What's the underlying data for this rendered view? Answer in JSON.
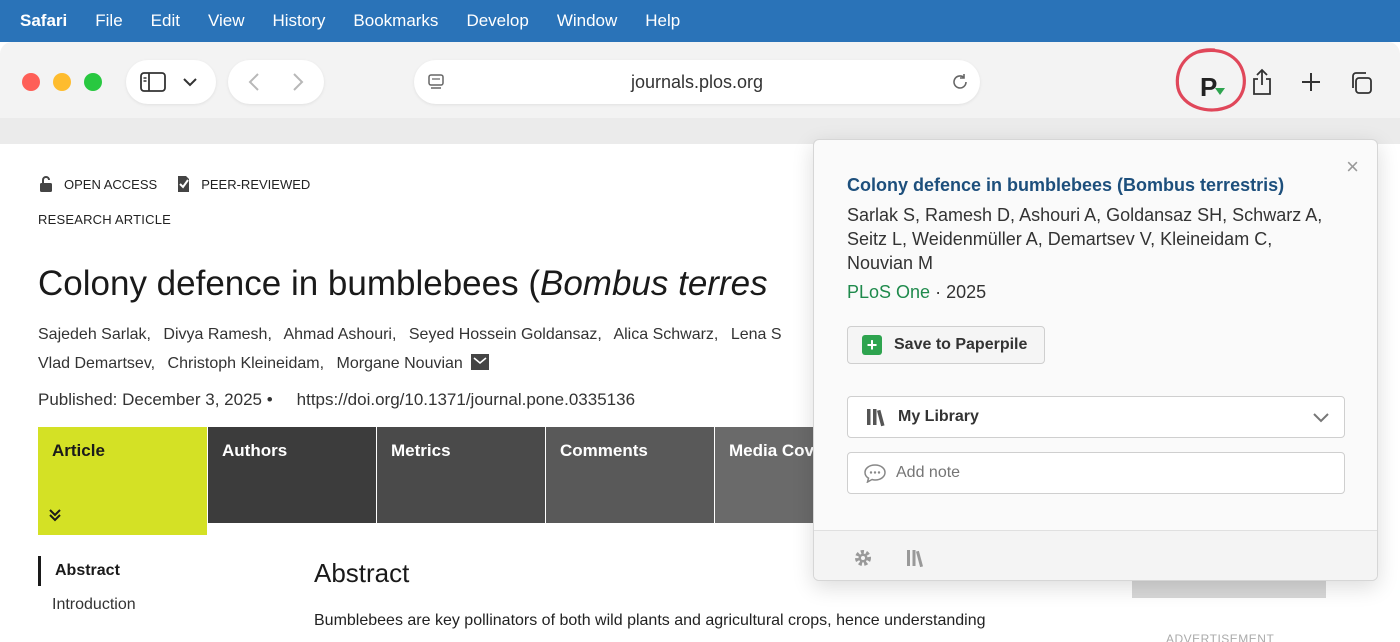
{
  "menubar": {
    "app": "Safari",
    "items": [
      "File",
      "Edit",
      "View",
      "History",
      "Bookmarks",
      "Develop",
      "Window",
      "Help"
    ]
  },
  "browser": {
    "url": "journals.plos.org",
    "paperpile_icon_letter": "P"
  },
  "article": {
    "badges": [
      "OPEN ACCESS",
      "PEER-REVIEWED"
    ],
    "type": "RESEARCH ARTICLE",
    "title_prefix": "Colony defence in bumblebees (",
    "title_species": "Bombus terres",
    "authors_line1": [
      "Sajedeh Sarlak,",
      "Divya Ramesh,",
      "Ahmad Ashouri,",
      "Seyed Hossein Goldansaz,",
      "Alica Schwarz,",
      "Lena S"
    ],
    "authors_line2": [
      "Vlad Demartsev,",
      "Christoph Kleineidam,",
      "Morgane Nouvian"
    ],
    "published": "Published: December 3, 2025 •",
    "doi": "https://doi.org/10.1371/journal.pone.0335136",
    "tabs": [
      "Article",
      "Authors",
      "Metrics",
      "Comments",
      "Media Cov"
    ],
    "toc": [
      "Abstract",
      "Introduction"
    ],
    "abstract_heading": "Abstract",
    "abstract_text": "Bumblebees are key pollinators of both wild plants and agricultural crops, hence understanding",
    "ad_label": "ADVERTISEMENT"
  },
  "paperpile": {
    "title": "Colony defence in bumblebees (Bombus terrestris)",
    "authors": "Sarlak S, Ramesh D, Ashouri A, Goldansaz SH, Schwarz A, Seitz L, Weidenmüller A, Demartsev V, Kleineidam C, Nouvian M",
    "journal": "PLoS One",
    "year": "· 2025",
    "save_label": "Save to Paperpile",
    "library_label": "My Library",
    "note_placeholder": "Add note",
    "close": "×"
  },
  "colors": {
    "menubar": "#2a73b8",
    "active_tab": "#d4e125",
    "journal_green": "#1f8a4c",
    "title_blue": "#1d4f7c",
    "annotation_red": "#e0475a"
  }
}
